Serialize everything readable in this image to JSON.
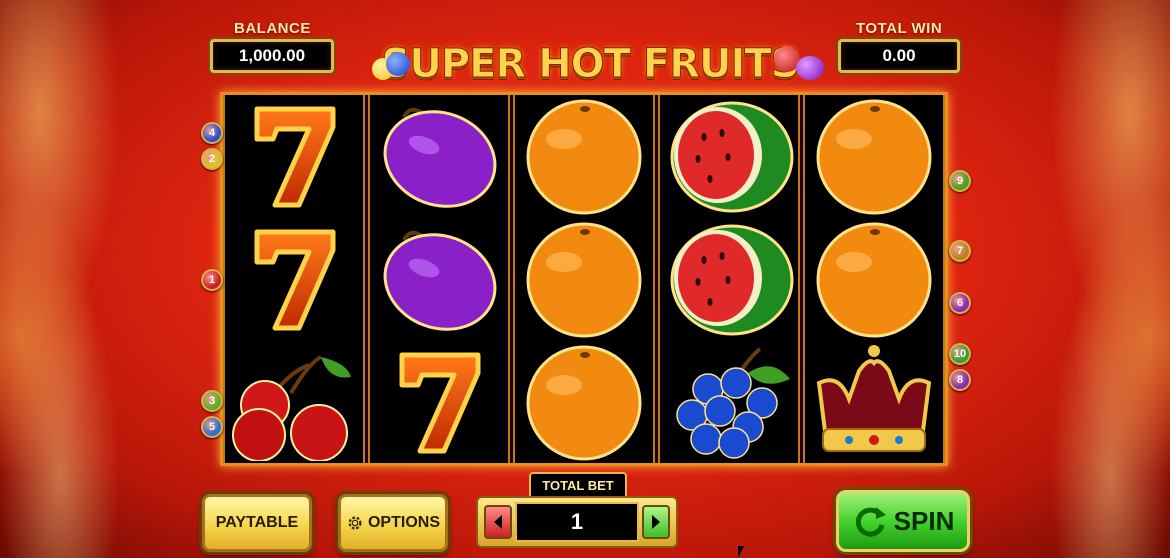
{
  "header": {
    "balance_label": "BALANCE",
    "balance_value": "1,000.00",
    "total_win_label": "TOTAL WIN",
    "total_win_value": "0.00",
    "logo_text": "SUPER HOT FRUITS"
  },
  "reels": [
    [
      "seven",
      "seven",
      "cherries"
    ],
    [
      "plum",
      "plum",
      "seven"
    ],
    [
      "orange",
      "orange",
      "orange"
    ],
    [
      "watermelon",
      "watermelon",
      "grapes"
    ],
    [
      "orange",
      "orange",
      "crown"
    ]
  ],
  "paylines_left": [
    {
      "num": "4",
      "color": "#2a4fd0"
    },
    {
      "num": "2",
      "color": "#e0c020"
    },
    {
      "num": "1",
      "color": "#d02020"
    },
    {
      "num": "3",
      "color": "#5ab020"
    },
    {
      "num": "5",
      "color": "#2a6fd0"
    }
  ],
  "paylines_right": [
    {
      "num": "9",
      "color": "#4aa020"
    },
    {
      "num": "7",
      "color": "#c08020"
    },
    {
      "num": "6",
      "color": "#8a2ab0"
    },
    {
      "num": "10",
      "color": "#30a030"
    },
    {
      "num": "8",
      "color": "#8a2ab0"
    }
  ],
  "controls": {
    "paytable_label": "PAYTABLE",
    "options_label": "OPTIONS",
    "total_bet_label": "TOTAL BET",
    "total_bet_value": "1",
    "spin_label": "SPIN"
  },
  "colors": {
    "background": "#dd2410",
    "frame_gold": "#e8b84a",
    "spin_green": "#3fcf2a"
  }
}
